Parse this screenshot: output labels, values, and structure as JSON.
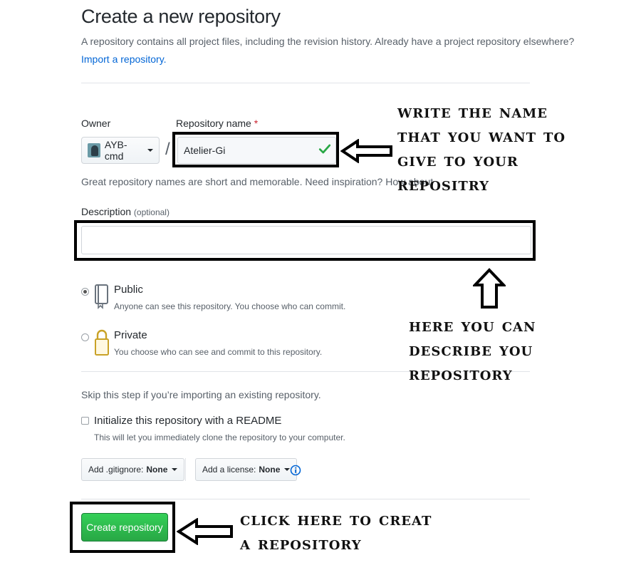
{
  "header": {
    "title": "Create a new repository",
    "subtitle": "A repository contains all project files, including the revision history. Already have a project repository elsewhere?",
    "import_link": "Import a repository."
  },
  "owner": {
    "label": "Owner",
    "value": "AYB-cmd"
  },
  "repo_name": {
    "label": "Repository name",
    "required_mark": "*",
    "value": "Atelier-Gi"
  },
  "slash": "/",
  "name_hint": "Great repository names are short and memorable. Need inspiration? How about",
  "description": {
    "label": "Description",
    "optional": "(optional)",
    "value": ""
  },
  "visibility": {
    "public": {
      "title": "Public",
      "note": "Anyone can see this repository. You choose who can commit.",
      "checked": true
    },
    "private": {
      "title": "Private",
      "note": "You choose who can see and commit to this repository.",
      "checked": false
    }
  },
  "skip_note": "Skip this step if you’re importing an existing repository.",
  "init_readme": {
    "title": "Initialize this repository with a README",
    "note": "This will let you immediately clone the repository to your computer.",
    "checked": false
  },
  "gitignore": {
    "label": "Add .gitignore:",
    "value": "None"
  },
  "license": {
    "label": "Add a license:",
    "value": "None"
  },
  "create_button": "Create repository",
  "annotations": {
    "name": "Write the name\nthat you want to\ngive to your\nrepositry",
    "description": "Here you can\ndescribe you\nrepository",
    "create": "Click here to creat\na repository"
  },
  "colors": {
    "link": "#0366d6",
    "create_green": "#28a745",
    "check_green": "#28a745",
    "required_red": "#cb2431"
  }
}
